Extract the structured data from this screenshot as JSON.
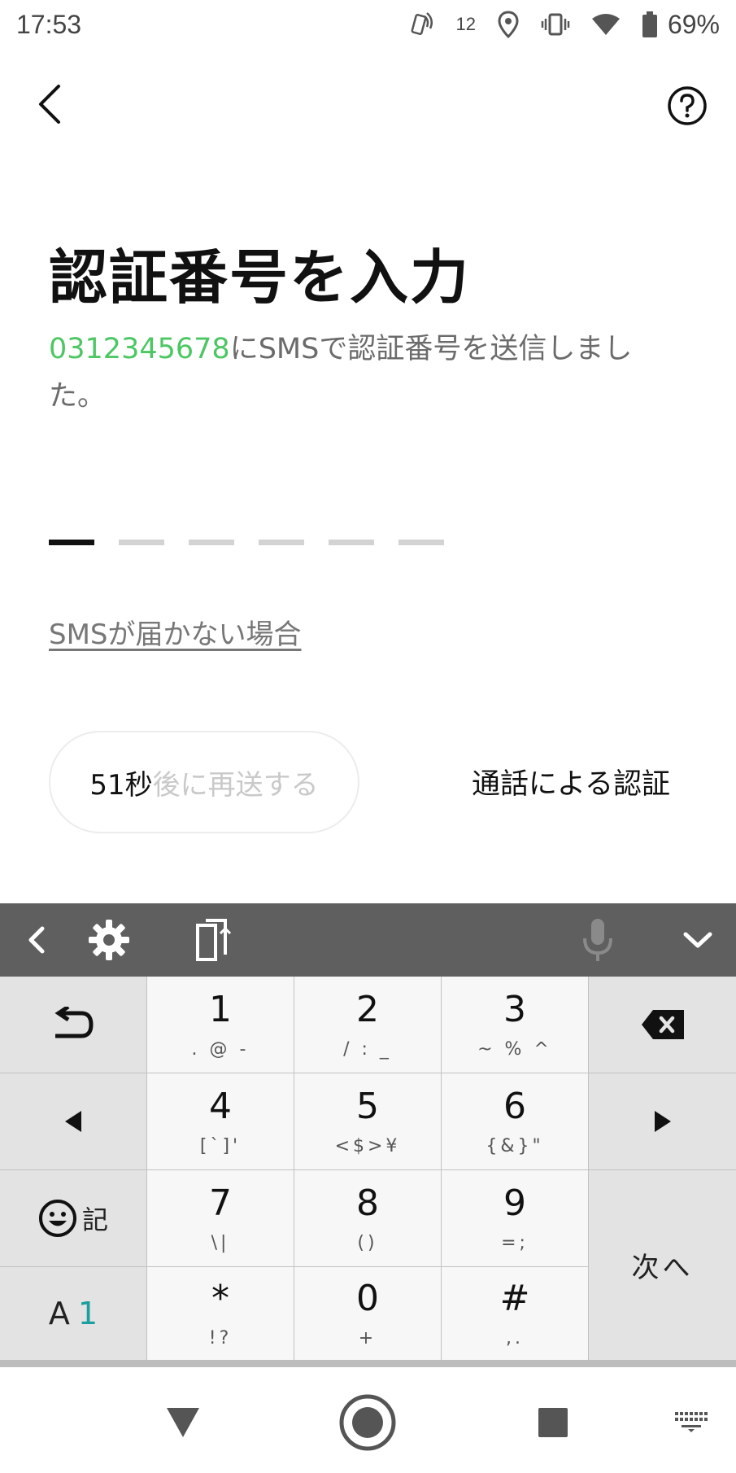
{
  "status_bar": {
    "time": "17:53",
    "notification_count": "12",
    "battery": "69%",
    "icons": [
      "nfc-tap-icon",
      "location-icon",
      "vibrate-icon",
      "wifi-icon",
      "battery-icon"
    ]
  },
  "app_bar": {
    "back_icon": "chevron-left-icon",
    "help_icon": "help-circle-icon"
  },
  "title": "認証番号を入力",
  "description": {
    "phone_number": "0312345678",
    "message": "にSMSで認証番号を送信しました。"
  },
  "code_input": {
    "digits": 6,
    "active_index": 0
  },
  "sms_help_link": "SMSが届かない場合",
  "resend": {
    "seconds": "51秒",
    "label": "後に再送する"
  },
  "call_verify": "通話による認証",
  "keyboard": {
    "toolbar_icons": [
      "chevron-left-icon",
      "gear-icon",
      "clipboard-icon",
      "mic-icon",
      "chevron-down-icon"
    ],
    "keys": [
      {
        "main": "1",
        "sub": ". @ -"
      },
      {
        "main": "2",
        "sub": "/ : _"
      },
      {
        "main": "3",
        "sub": "~ % ^"
      },
      {
        "main": "4",
        "sub": "[`]'"
      },
      {
        "main": "5",
        "sub": "<$>¥"
      },
      {
        "main": "6",
        "sub": "{&}\""
      },
      {
        "main": "7",
        "sub": "\\|"
      },
      {
        "main": "8",
        "sub": "()"
      },
      {
        "main": "9",
        "sub": "=;"
      },
      {
        "main": "*",
        "sub": "!?"
      },
      {
        "main": "0",
        "sub": "+"
      },
      {
        "main": "#",
        "sub": ",."
      }
    ],
    "emoji_label": "記",
    "mode_letter": "A",
    "mode_digit": "1",
    "next_label": "次へ",
    "accent_color": "#1a9e9e"
  },
  "nav_bar": {
    "icons": [
      "nav-back-triangle-icon",
      "nav-home-icon",
      "nav-recents-icon",
      "keyboard-switch-icon"
    ]
  },
  "colors": {
    "brand_green": "#4cc764",
    "toolbar_gray": "#5f5f5f"
  }
}
